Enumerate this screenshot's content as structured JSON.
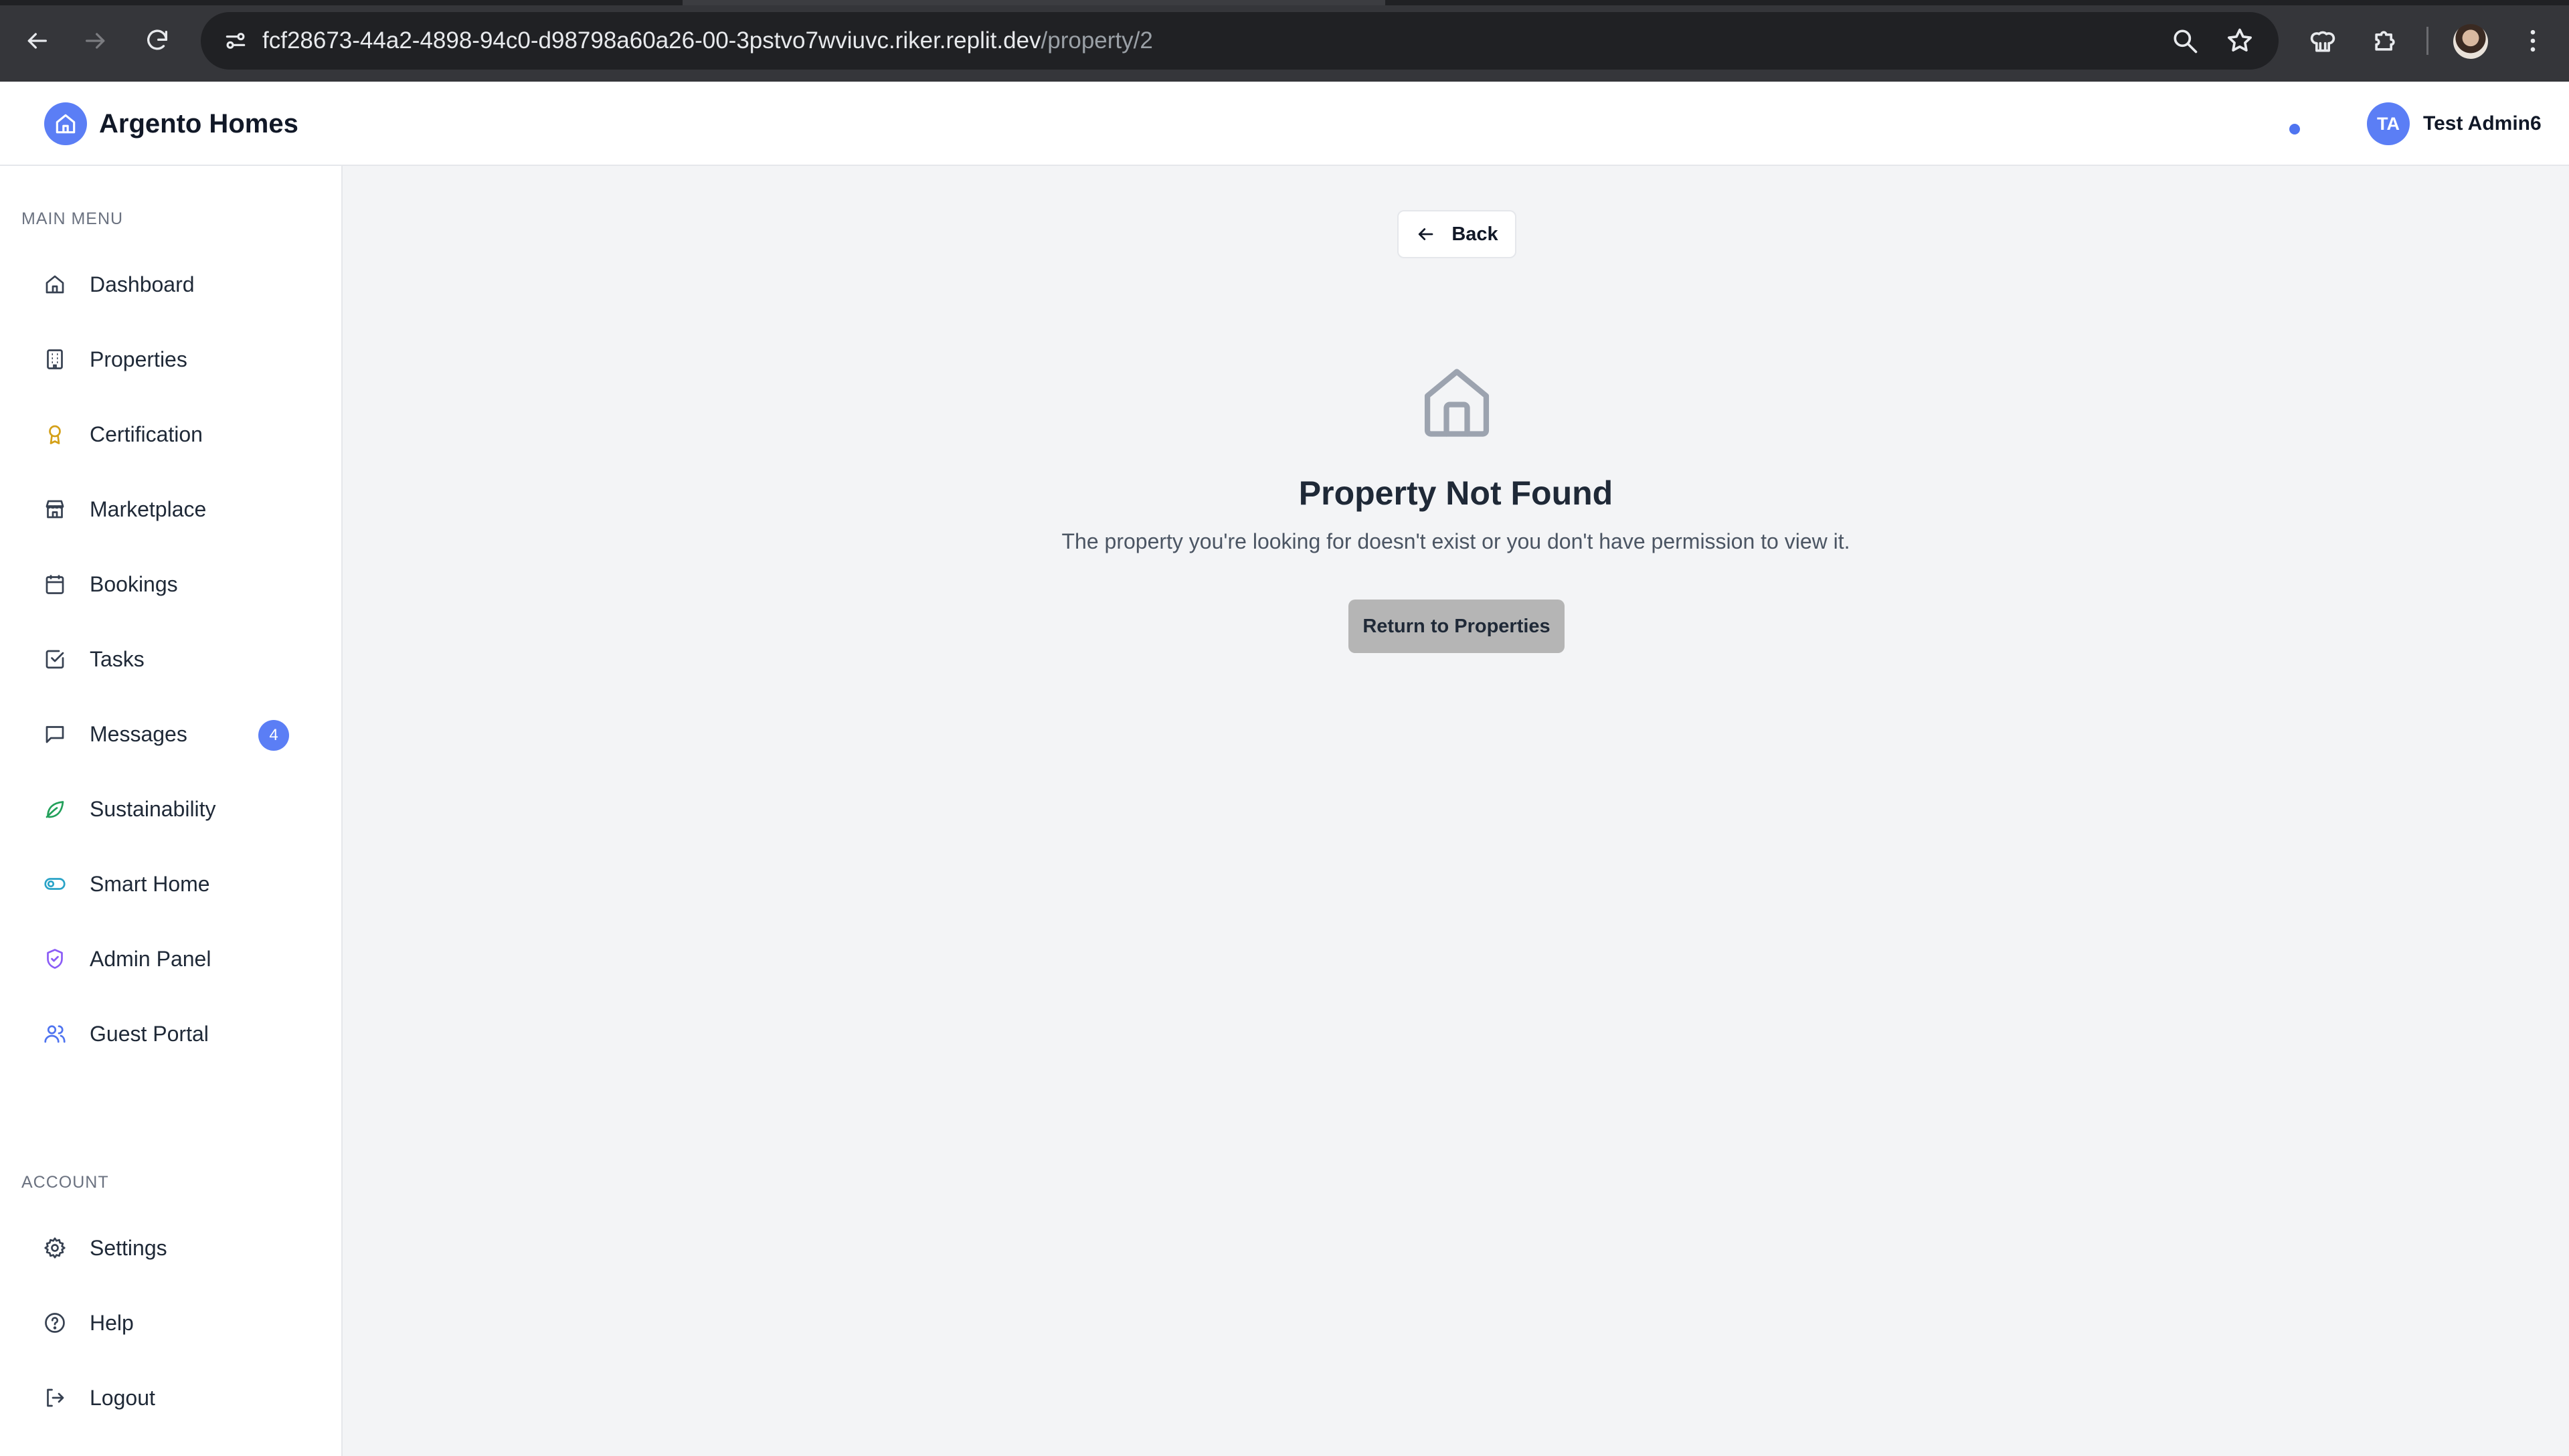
{
  "browser": {
    "url_host": "fcf28673-44a2-4898-94c0-d98798a60a26-00-3pstvo7wviuvc.riker.replit.dev",
    "url_path": "/property/2"
  },
  "header": {
    "brand": "Argento Homes",
    "user_initials": "TA",
    "user_name": "Test Admin6"
  },
  "sidebar": {
    "main_menu_title": "MAIN MENU",
    "account_title": "ACCOUNT",
    "items": [
      {
        "label": "Dashboard",
        "icon": "home-icon"
      },
      {
        "label": "Properties",
        "icon": "building-icon"
      },
      {
        "label": "Certification",
        "icon": "award-icon"
      },
      {
        "label": "Marketplace",
        "icon": "store-icon"
      },
      {
        "label": "Bookings",
        "icon": "calendar-icon"
      },
      {
        "label": "Tasks",
        "icon": "check-square-icon"
      },
      {
        "label": "Messages",
        "icon": "message-icon",
        "badge": "4"
      },
      {
        "label": "Sustainability",
        "icon": "leaf-icon"
      },
      {
        "label": "Smart Home",
        "icon": "toggle-icon"
      },
      {
        "label": "Admin Panel",
        "icon": "shield-icon"
      },
      {
        "label": "Guest Portal",
        "icon": "users-icon"
      }
    ],
    "account_items": [
      {
        "label": "Settings",
        "icon": "gear-icon"
      },
      {
        "label": "Help",
        "icon": "help-circle-icon"
      },
      {
        "label": "Logout",
        "icon": "logout-icon"
      }
    ]
  },
  "main": {
    "back_label": "Back",
    "title": "Property Not Found",
    "description": "The property you're looking for doesn't exist or you don't have permission to view it.",
    "return_label": "Return to Properties"
  },
  "colors": {
    "accent": "#5b7ef5",
    "certification": "#d4a017",
    "sustainability": "#22a05a",
    "smart_home": "#29a3c7",
    "admin": "#8b5cf6",
    "guest": "#4f74f0"
  }
}
